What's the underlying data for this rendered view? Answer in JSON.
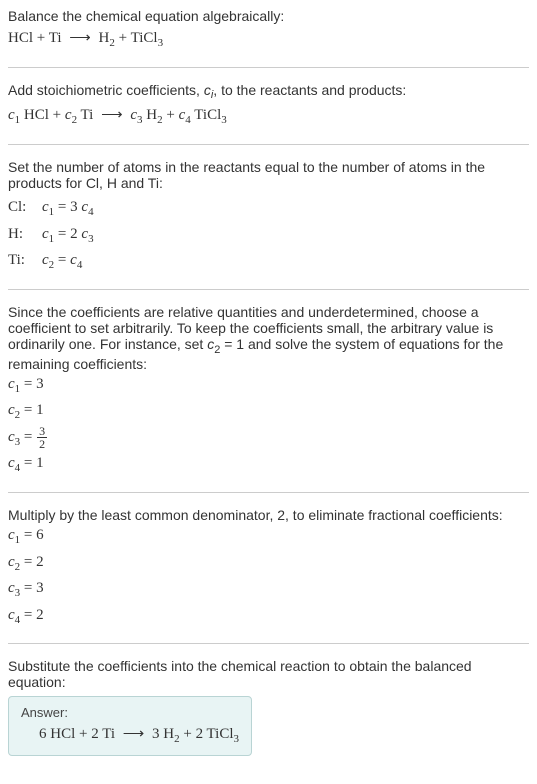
{
  "section1": {
    "text": "Balance the chemical equation algebraically:",
    "eq_lhs1": "HCl",
    "plus": " + ",
    "eq_lhs2": "Ti",
    "arrow": "⟶",
    "eq_rhs1": "H",
    "eq_rhs1_sub": "2",
    "eq_rhs2": "TiCl",
    "eq_rhs2_sub": "3"
  },
  "section2": {
    "text_a": "Add stoichiometric coefficients, ",
    "ci": "c",
    "ci_sub": "i",
    "text_b": ", to the reactants and products:",
    "c1": "c",
    "c1_sub": "1",
    "t1": " HCl + ",
    "c2": "c",
    "c2_sub": "2",
    "t2": " Ti ",
    "arrow": "⟶",
    "c3": "c",
    "c3_sub": "3",
    "t3": " H",
    "t3_sub": "2",
    "t3b": " + ",
    "c4": "c",
    "c4_sub": "4",
    "t4": " TiCl",
    "t4_sub": "3"
  },
  "section3": {
    "text": "Set the number of atoms in the reactants equal to the number of atoms in the products for Cl, H and Ti:",
    "rows": [
      {
        "label": "Cl:",
        "lhs": "c",
        "lhs_sub": "1",
        "eq": " = 3",
        "rhs": "c",
        "rhs_sub": "4"
      },
      {
        "label": "H:",
        "lhs": "c",
        "lhs_sub": "1",
        "eq": " = 2",
        "rhs": "c",
        "rhs_sub": "3"
      },
      {
        "label": "Ti:",
        "lhs": "c",
        "lhs_sub": "2",
        "eq": " = ",
        "rhs": "c",
        "rhs_sub": "4"
      }
    ]
  },
  "section4": {
    "text_a": "Since the coefficients are relative quantities and underdetermined, choose a coefficient to set arbitrarily. To keep the coefficients small, the arbitrary value is ordinarily one. For instance, set ",
    "cset": "c",
    "cset_sub": "2",
    "cset_val": " = 1",
    "text_b": " and solve the system of equations for the remaining coefficients:",
    "l1_c": "c",
    "l1_sub": "1",
    "l1_val": " = 3",
    "l2_c": "c",
    "l2_sub": "2",
    "l2_val": " = 1",
    "l3_c": "c",
    "l3_sub": "3",
    "l3_eq": " = ",
    "l3_num": "3",
    "l3_den": "2",
    "l4_c": "c",
    "l4_sub": "4",
    "l4_val": " = 1"
  },
  "section5": {
    "text": "Multiply by the least common denominator, 2, to eliminate fractional coefficients:",
    "l1_c": "c",
    "l1_sub": "1",
    "l1_val": " = 6",
    "l2_c": "c",
    "l2_sub": "2",
    "l2_val": " = 2",
    "l3_c": "c",
    "l3_sub": "3",
    "l3_val": " = 3",
    "l4_c": "c",
    "l4_sub": "4",
    "l4_val": " = 2"
  },
  "section6": {
    "text": "Substitute the coefficients into the chemical reaction to obtain the balanced equation:",
    "answer_label": "Answer:",
    "eq_a": "6 HCl + 2 Ti ",
    "arrow": "⟶",
    "eq_b": " 3 H",
    "eq_b_sub": "2",
    "eq_c": " + 2 TiCl",
    "eq_c_sub": "3"
  }
}
